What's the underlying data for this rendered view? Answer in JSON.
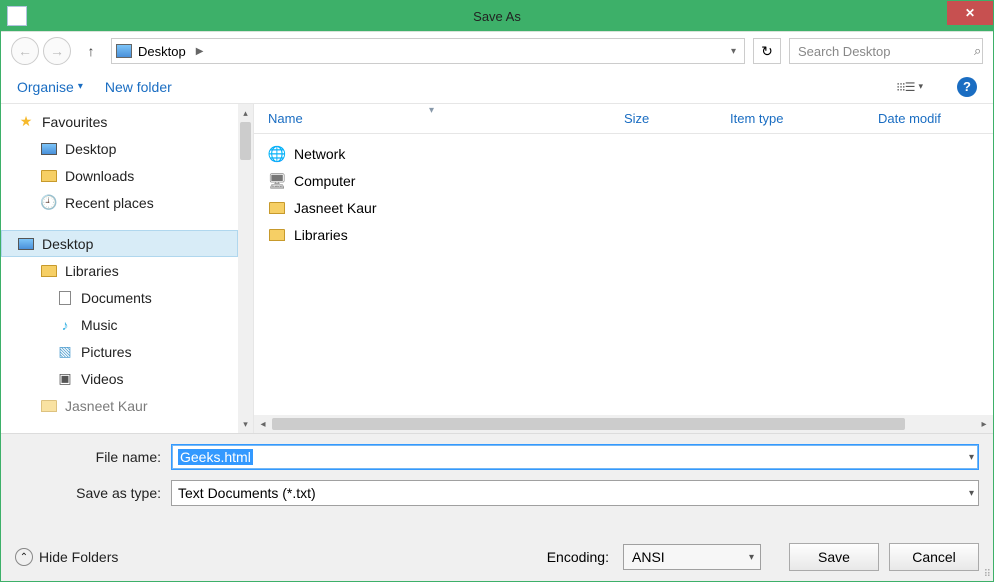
{
  "title": "Save As",
  "navigation": {
    "location": "Desktop",
    "search_placeholder": "Search Desktop"
  },
  "toolbar": {
    "organise": "Organise",
    "new_folder": "New folder"
  },
  "tree": {
    "favourites": "Favourites",
    "fav_items": [
      "Desktop",
      "Downloads",
      "Recent places"
    ],
    "desktop": "Desktop",
    "libraries": "Libraries",
    "lib_items": [
      "Documents",
      "Music",
      "Pictures",
      "Videos"
    ],
    "user": "Jasneet Kaur"
  },
  "filepane": {
    "columns": {
      "name": "Name",
      "size": "Size",
      "type": "Item type",
      "date": "Date modif"
    },
    "items": [
      "Network",
      "Computer",
      "Jasneet Kaur",
      "Libraries"
    ]
  },
  "fields": {
    "file_name_label": "File name:",
    "file_name_value": "Geeks.html",
    "save_type_label": "Save as type:",
    "save_type_value": "Text Documents (*.txt)"
  },
  "footer": {
    "hide_folders": "Hide Folders",
    "encoding_label": "Encoding:",
    "encoding_value": "ANSI",
    "save": "Save",
    "cancel": "Cancel"
  }
}
